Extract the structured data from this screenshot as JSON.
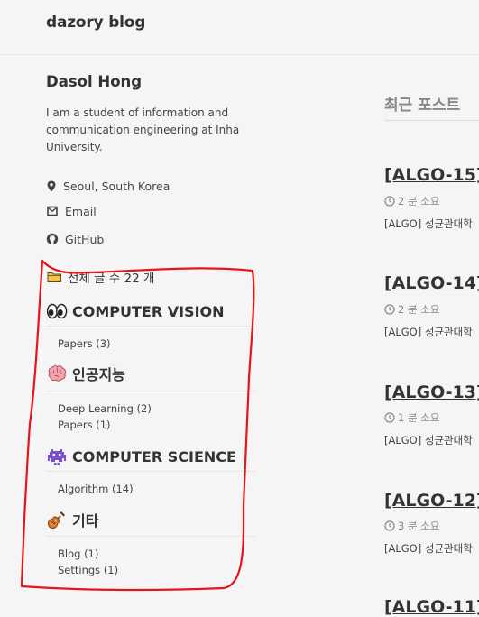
{
  "masthead": {
    "site_title": "dazory blog"
  },
  "author": {
    "name": "Dasol Hong",
    "bio": "I am a student of information and communication engineering at Inha University.",
    "links": [
      {
        "label": "Seoul, South Korea",
        "icon": "map-marker-icon"
      },
      {
        "label": "Email",
        "icon": "envelope-icon"
      },
      {
        "label": "GitHub",
        "icon": "github-icon"
      }
    ]
  },
  "categories": {
    "total_label": "전체 글 수 22 개",
    "total_icon": "folder-icon",
    "groups": [
      {
        "title": "COMPUTER VISION",
        "icon": "eyes-icon",
        "items": [
          "Papers (3)"
        ]
      },
      {
        "title": "인공지능",
        "icon": "brain-icon",
        "items": [
          "Deep Learning (2)",
          "Papers (1)"
        ]
      },
      {
        "title": "COMPUTER SCIENCE",
        "icon": "alien-monster-icon",
        "items": [
          "Algorithm (14)"
        ]
      },
      {
        "title": "기타",
        "icon": "guitar-icon",
        "items": [
          "Blog (1)",
          "Settings (1)"
        ]
      }
    ]
  },
  "recent": {
    "title": "최근 포스트",
    "posts": [
      {
        "title": "[ALGO-15]",
        "read_time": "2 분 소요",
        "excerpt": "[ALGO] 성균관대학"
      },
      {
        "title": "[ALGO-14]",
        "read_time": "2 분 소요",
        "excerpt": "[ALGO] 성균관대학"
      },
      {
        "title": "[ALGO-13]",
        "read_time": "1 분 소요",
        "excerpt": "[ALGO] 성균관대학"
      },
      {
        "title": "[ALGO-12]",
        "read_time": "3 분 소요",
        "excerpt": "[ALGO] 성균관대학"
      },
      {
        "title": "[ALGO-11]"
      }
    ]
  },
  "colors": {
    "annotation": "#e8141c",
    "rule": "#ece6d8",
    "text": "#333333",
    "muted": "#888888"
  }
}
